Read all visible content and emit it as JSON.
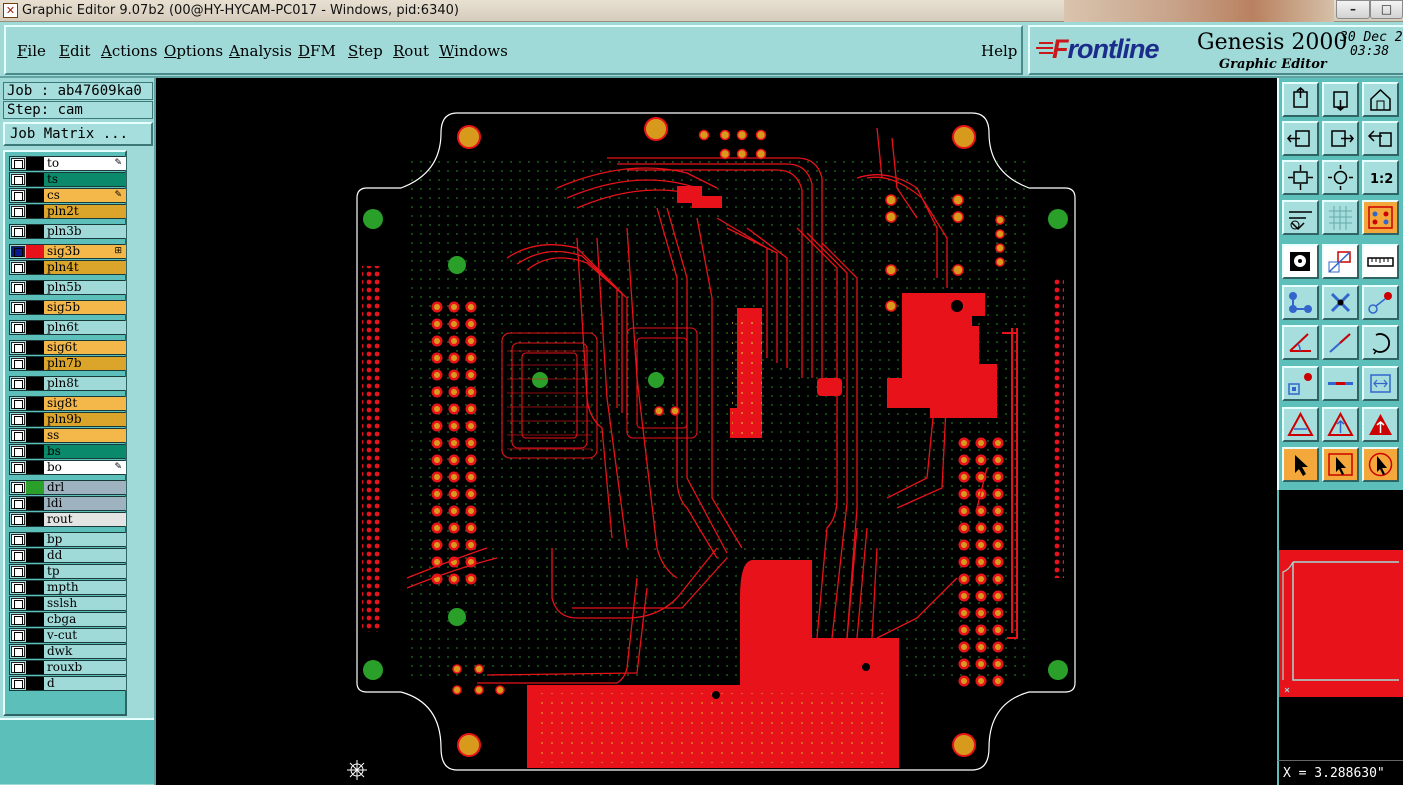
{
  "window": {
    "title": "Graphic Editor 9.07b2 (00@HY-HYCAM-PC017 - Windows, pid:6340)",
    "controls": [
      "–",
      "□",
      "✕"
    ]
  },
  "menubar": {
    "items": [
      {
        "label": "File",
        "accel": "F",
        "rest": "ile"
      },
      {
        "label": "Edit",
        "accel": "E",
        "rest": "dit"
      },
      {
        "label": "Actions",
        "accel": "A",
        "rest": "ctions"
      },
      {
        "label": "Options",
        "accel": "O",
        "rest": "ptions"
      },
      {
        "label": "Analysis",
        "accel": "A",
        "rest": "nalysis"
      },
      {
        "label": "DFM",
        "accel": "D",
        "rest": "FM"
      },
      {
        "label": "Step",
        "accel": "S",
        "rest": "tep"
      },
      {
        "label": "Rout",
        "accel": "R",
        "rest": "out"
      },
      {
        "label": "Windows",
        "accel": "W",
        "rest": "indows"
      }
    ],
    "help": "Help"
  },
  "brand": {
    "logo_first": "F",
    "logo_rest": "rontline",
    "product": "Genesis 2000",
    "subtitle": "Graphic Editor",
    "date": "30 Dec 2",
    "time": "03:38"
  },
  "job": {
    "job_label": "Job : ab47609ka0",
    "step_label": "Step: cam",
    "matrix_button": "Job Matrix ..."
  },
  "layers": [
    {
      "name": "to",
      "color": "#ffffff",
      "swatch": "#000000",
      "mark": "✎"
    },
    {
      "name": "ts",
      "color": "#0a8a6a",
      "swatch": "#000000",
      "mark": ""
    },
    {
      "name": "cs",
      "color": "#f4b84a",
      "swatch": "#000000",
      "mark": "✎"
    },
    {
      "name": "pln2t",
      "color": "#dba42a",
      "swatch": "#000000",
      "mark": ""
    },
    {
      "name": "pln3b",
      "color": "#9fd9d8",
      "swatch": "#000000",
      "mark": ""
    },
    {
      "name": "sig3b",
      "color": "#f4b84a",
      "swatch": "#e8131a",
      "mark": "⊞",
      "active": true
    },
    {
      "name": "pln4t",
      "color": "#dba42a",
      "swatch": "#000000",
      "mark": ""
    },
    {
      "name": "pln5b",
      "color": "#9fd9d8",
      "swatch": "#000000",
      "mark": ""
    },
    {
      "name": "sig5b",
      "color": "#f4b84a",
      "swatch": "#000000",
      "mark": ""
    },
    {
      "name": "pln6t",
      "color": "#9fd9d8",
      "swatch": "#000000",
      "mark": ""
    },
    {
      "name": "sig6t",
      "color": "#f4b84a",
      "swatch": "#000000",
      "mark": ""
    },
    {
      "name": "pln7b",
      "color": "#dba42a",
      "swatch": "#000000",
      "mark": ""
    },
    {
      "name": "pln8t",
      "color": "#9fd9d8",
      "swatch": "#000000",
      "mark": ""
    },
    {
      "name": "sig8t",
      "color": "#f4b84a",
      "swatch": "#000000",
      "mark": ""
    },
    {
      "name": "pln9b",
      "color": "#dba42a",
      "swatch": "#000000",
      "mark": ""
    },
    {
      "name": "ss",
      "color": "#f4b84a",
      "swatch": "#000000",
      "mark": ""
    },
    {
      "name": "bs",
      "color": "#0a8a6a",
      "swatch": "#000000",
      "mark": ""
    },
    {
      "name": "bo",
      "color": "#ffffff",
      "swatch": "#000000",
      "mark": "✎"
    },
    {
      "name": "drl",
      "color": "#9eb3bf",
      "swatch": "#2aa02a",
      "mark": ""
    },
    {
      "name": "ldi",
      "color": "#9eb3bf",
      "swatch": "#000000",
      "mark": ""
    },
    {
      "name": "rout",
      "color": "#e4e4e4",
      "swatch": "#000000",
      "mark": ""
    },
    {
      "name": "bp",
      "color": "#9fd9d8",
      "swatch": "#000000",
      "mark": ""
    },
    {
      "name": "dd",
      "color": "#9fd9d8",
      "swatch": "#000000",
      "mark": ""
    },
    {
      "name": "tp",
      "color": "#9fd9d8",
      "swatch": "#000000",
      "mark": ""
    },
    {
      "name": "mpth",
      "color": "#9fd9d8",
      "swatch": "#000000",
      "mark": ""
    },
    {
      "name": "sslsh",
      "color": "#9fd9d8",
      "swatch": "#000000",
      "mark": ""
    },
    {
      "name": "cbga",
      "color": "#9fd9d8",
      "swatch": "#000000",
      "mark": ""
    },
    {
      "name": "v-cut",
      "color": "#9fd9d8",
      "swatch": "#000000",
      "mark": ""
    },
    {
      "name": "dwk",
      "color": "#9fd9d8",
      "swatch": "#000000",
      "mark": ""
    },
    {
      "name": "rouxb",
      "color": "#9fd9d8",
      "swatch": "#000000",
      "mark": ""
    },
    {
      "name": "d",
      "color": "#9fd9d8",
      "swatch": "#000000",
      "mark": ""
    }
  ],
  "colors": {
    "panel": "#9fd9d8",
    "copper": "#e8131a",
    "pad": "#d89a1c",
    "drill": "#2aa02a",
    "outline": "#ffffff"
  },
  "tools": [
    "home-up-icon",
    "home-down-icon",
    "home-icon",
    "pan-left-icon",
    "pan-right-icon",
    "zoom-back-icon",
    "zoom-fit-icon",
    "zoom-center-icon",
    "zoom-1to2-icon",
    "measure-icon",
    "grid-icon",
    "layer-stack-icon",
    "snap-icon",
    "rect-select-icon",
    "ruler-icon",
    "connect-icon",
    "cross-icon",
    "point-to-point-icon",
    "angle-icon",
    "line-icon",
    "arc-icon",
    "pad-move-icon",
    "line-cut-icon",
    "frame-icon",
    "triangle-icon",
    "triangle-up-icon",
    "triangle-fill-icon",
    "pointer-icon",
    "pointer-box-icon",
    "pointer-circle-icon"
  ],
  "status": {
    "coords": "X = 3.288630\""
  }
}
